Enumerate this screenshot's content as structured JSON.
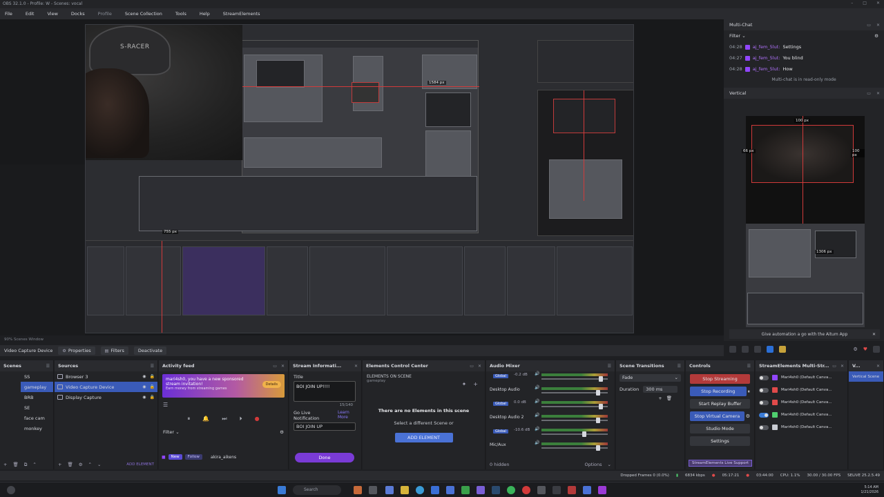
{
  "titlebar": {
    "text": "OBS 32.1.0 - Profile: W - Scenes: vocal"
  },
  "menu": [
    "File",
    "Edit",
    "View",
    "Docks",
    "Profile",
    "Scene Collection",
    "Tools",
    "Help",
    "StreamElements"
  ],
  "preview": {
    "webcam_chair_text": "S-RACER",
    "nested_px_top": "1584 px",
    "nested_px_bottom": "755 px"
  },
  "status_strip": "90%   Scenes Window",
  "context_bar": {
    "source": "Video Capture Device",
    "properties": "Properties",
    "filters": "Filters",
    "deactivate": "Deactivate"
  },
  "multichat": {
    "title": "Multi-Chat",
    "filter": "Filter",
    "lines": [
      {
        "time": "04:28",
        "user": "aj_fem_5lut:",
        "msg": "Settings"
      },
      {
        "time": "04:27",
        "user": "aj_fem_5lut:",
        "msg": "You blind"
      },
      {
        "time": "04:28",
        "user": "aj_fem_5lut:",
        "msg": "How"
      }
    ],
    "readonly": "Multi-chat is in read-only mode"
  },
  "vertical": {
    "title": "Vertical",
    "px_top": "100 px",
    "px_left": "66 px",
    "px_right": "100 px",
    "px_mid": "1306 px"
  },
  "automation": "Give automation a go with the Aitum App",
  "scenes": {
    "title": "Scenes",
    "items": [
      "SS",
      "gameplay",
      "BRB",
      "SE",
      "face cam",
      "monkey"
    ],
    "selected": 1
  },
  "sources": {
    "title": "Sources",
    "items": [
      "Browser 3",
      "Video Capture Device",
      "Display Capture"
    ],
    "selected": 1,
    "add_element": "ADD ELEMENT"
  },
  "activity": {
    "title": "Activity feed",
    "promo": "mari4sh0, you have a new sponsored stream invitation!",
    "promo_sub": "Earn money from streaming games",
    "promo_cta": "Details",
    "filter": "Filter",
    "new": "New",
    "follow": "Follow",
    "follower": "akira_aikens"
  },
  "stream_info": {
    "title": "Stream Informati...",
    "label_title": "Title",
    "title_value": "BOI JOIN UP!!!!",
    "count": "15/140",
    "go_live_label": "Go Live Notification",
    "learn_more": "Learn More",
    "go_live_value": "BOI JOIN UP",
    "done": "Done"
  },
  "ecc": {
    "title": "Elements Control Center",
    "sub": "ELEMENTS ON SCENE",
    "sub2": "gameplay",
    "empty": "There are no Elements in this scene",
    "hint": "Select a different Scene or",
    "add": "ADD ELEMENT"
  },
  "mixer": {
    "title": "Audio Mixer",
    "global": "Global",
    "channels": [
      {
        "name": "",
        "db": "-0.2 dB",
        "knob": 0.92
      },
      {
        "name": "Desktop Audio",
        "db": "",
        "knob": 0.88
      },
      {
        "name": "",
        "db": "0.0 dB",
        "knob": 0.92
      },
      {
        "name": "Desktop Audio 2",
        "db": "",
        "knob": 0.88
      },
      {
        "name": "",
        "db": "-10.6 dB",
        "knob": 0.66
      },
      {
        "name": "Mic/Aux",
        "db": "",
        "knob": 0.88
      }
    ],
    "hidden": "0 hidden",
    "options": "Options"
  },
  "transitions": {
    "title": "Scene Transitions",
    "type": "Fade",
    "duration_label": "Duration",
    "duration_value": "300 ms"
  },
  "controls": {
    "title": "Controls",
    "stop_streaming": "Stop Streaming",
    "stop_recording": "Stop Recording",
    "replay": "Start Replay Buffer",
    "virtual_cam": "Stop Virtual Camera",
    "studio": "Studio Mode",
    "settings": "Settings",
    "support": "StreamElements Live Support"
  },
  "multistream": {
    "title": "StreamElements Multi-Str...",
    "rows": [
      {
        "name": "Mari4sh0 (Default Canva...",
        "on": false,
        "color": "#9146ff"
      },
      {
        "name": "Mari4sh0 (Default Canva...",
        "on": false,
        "color": "#e04a4a"
      },
      {
        "name": "Mari4sh0 (Default Canva...",
        "on": false,
        "color": "#e04a4a"
      },
      {
        "name": "Mari4sh0 (Default Canva...",
        "on": true,
        "color": "#4fcf6f"
      },
      {
        "name": "Mari4sh0 (Default Canva...",
        "on": false,
        "color": "#c9ccd3"
      }
    ]
  },
  "vertical_dock": {
    "title": "V...",
    "button": "Vertical Scene"
  },
  "status": {
    "dropped": "Dropped Frames 0 (0.0%)",
    "kbps": "6834 kbps",
    "stream_time": "05:17:21",
    "rec_time": "03:44:00",
    "cpu": "CPU: 1.1%",
    "fps": "30.00 / 30.00 FPS",
    "right": "SELIVE 25.2.5.49"
  },
  "taskbar": {
    "search": "Search",
    "time": "5:14 AM",
    "date": "1/21/2026"
  },
  "colors": {
    "accent": "#3a5bb8",
    "record_red": "#b33a3a",
    "twitch": "#9146ff",
    "done_purple": "#7a3bd6"
  }
}
